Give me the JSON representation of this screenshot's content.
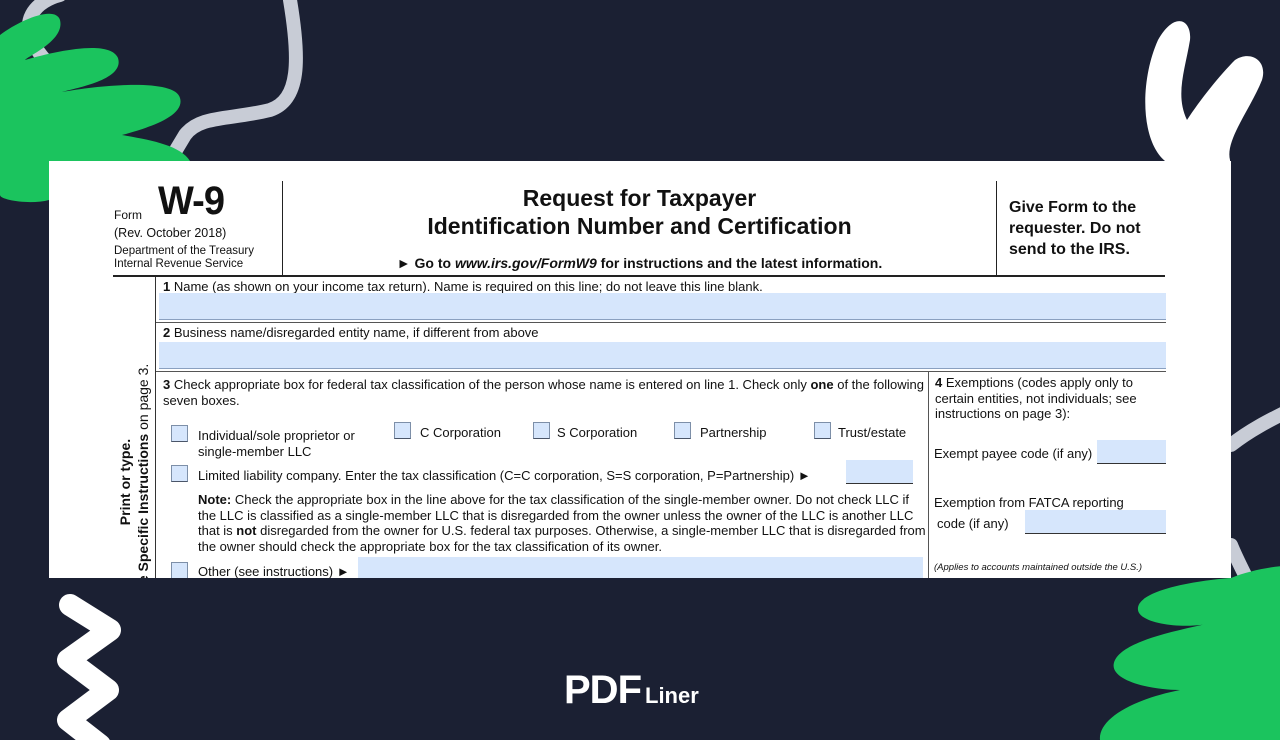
{
  "colors": {
    "background": "#1b2033",
    "accent_green": "#1bc45e",
    "decor_gray": "#c8ccd6",
    "field_fill": "#d6e6fc"
  },
  "header": {
    "form_word": "Form",
    "form_number": "W-9",
    "revision": "(Rev. October 2018)",
    "department": "Department of the Treasury",
    "agency": "Internal Revenue Service",
    "title_line1": "Request for Taxpayer",
    "title_line2": "Identification Number and Certification",
    "goto_prefix": "► Go to ",
    "goto_url": "www.irs.gov/FormW9",
    "goto_suffix": " for instructions and the latest information.",
    "notice": "Give Form to the requester. Do not send to the IRS."
  },
  "sidebar": {
    "line1": "Print or type.",
    "line2_bold": "See Specific Instructions",
    "line2_rest": " on page 3."
  },
  "line1": {
    "number": "1",
    "label": " Name (as shown on your income tax return). Name is required on this line; do not leave this line blank.",
    "value": ""
  },
  "line2": {
    "number": "2",
    "label": " Business name/disregarded entity name, if different from above",
    "value": ""
  },
  "line3": {
    "number": "3",
    "label_a": " Check appropriate box for federal tax classification of the person whose name is entered on line 1. Check only ",
    "label_bold": "one",
    "label_b": " of the following seven boxes.",
    "options": [
      {
        "label": "Individual/sole proprietor or single-member LLC",
        "checked": false
      },
      {
        "label": "C Corporation",
        "checked": false
      },
      {
        "label": "S Corporation",
        "checked": false
      },
      {
        "label": "Partnership",
        "checked": false
      },
      {
        "label": "Trust/estate",
        "checked": false
      }
    ],
    "llc": {
      "label": "Limited liability company. Enter the tax classification (C=C corporation, S=S corporation, P=Partnership) ►",
      "checked": false,
      "value": ""
    },
    "note_bold": "Note:",
    "note_a": " Check the appropriate box in the line above for the tax classification of the single-member owner.  Do not check LLC if the LLC is classified as a single-member LLC that is disregarded from the owner unless the owner of the LLC is another LLC that is ",
    "note_not": "not",
    "note_b": " disregarded from the owner for U.S. federal tax purposes. Otherwise, a single-member LLC that is disregarded from the owner should check the appropriate box for the tax classification of its owner.",
    "other": {
      "label": "Other (see instructions) ►",
      "checked": false,
      "value": ""
    }
  },
  "line4": {
    "number": "4",
    "title": "  Exemptions (codes apply only to certain entities, not individuals; see instructions on page 3):",
    "exempt_payee_label": "Exempt payee code (if any)",
    "exempt_payee_value": "",
    "fatca_label_1": "Exemption from FATCA reporting",
    "fatca_label_2": "code (if any)",
    "fatca_value": "",
    "fatca_note": "(Applies to accounts maintained outside the U.S.)"
  },
  "brand": {
    "name_main": "PDF",
    "name_sub": "Liner"
  }
}
